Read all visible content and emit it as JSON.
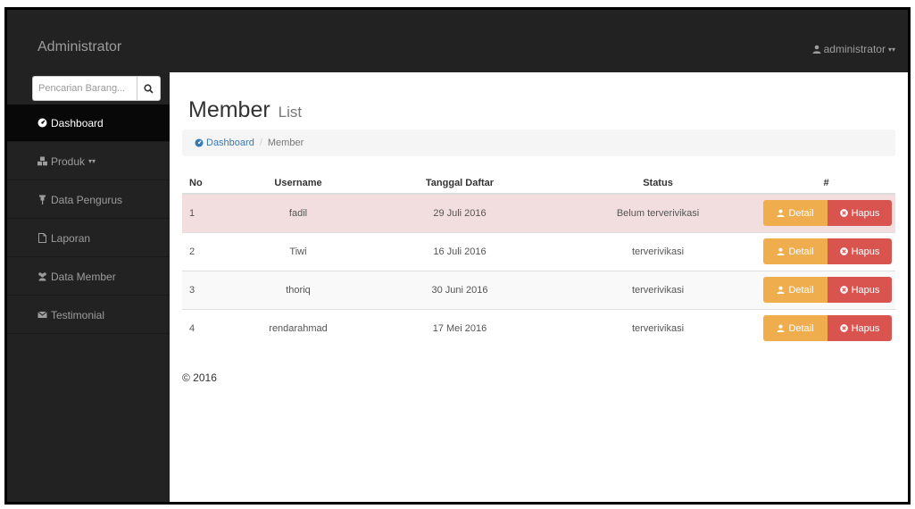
{
  "navbar": {
    "brand": "Administrator",
    "user_label": "administrator",
    "user_icon": "user-icon",
    "caret": "▾▾"
  },
  "sidebar": {
    "search_placeholder": "Pencarian Barang...",
    "search_icon": "search-icon",
    "items": [
      {
        "label": "Dashboard",
        "icon": "dashboard-icon",
        "active": true
      },
      {
        "label": "Produk",
        "icon": "cubes-icon",
        "caret": "▾▾"
      },
      {
        "label": "Data Pengurus",
        "icon": "pin-icon"
      },
      {
        "label": "Laporan",
        "icon": "file-icon"
      },
      {
        "label": "Data Member",
        "icon": "users-icon"
      },
      {
        "label": "Testimonial",
        "icon": "envelope-icon"
      }
    ]
  },
  "page": {
    "title": "Member",
    "subtitle": "List"
  },
  "breadcrumb": {
    "home": "Dashboard",
    "separator": "/",
    "current": "Member"
  },
  "table": {
    "headers": [
      "No",
      "Username",
      "Tanggal Daftar",
      "Status",
      "#"
    ],
    "rows": [
      {
        "no": "1",
        "username": "fadil",
        "date": "29 Juli 2016",
        "status": "Belum terverivikasi"
      },
      {
        "no": "2",
        "username": "Tiwi",
        "date": "16 Juli 2016",
        "status": "terverivikasi"
      },
      {
        "no": "3",
        "username": "thoriq",
        "date": "30 Juni 2016",
        "status": "terverivikasi"
      },
      {
        "no": "4",
        "username": "rendarahmad",
        "date": "17 Mei 2016",
        "status": "terverivikasi"
      }
    ],
    "detail_label": "Detail",
    "hapus_label": "Hapus"
  },
  "footer": {
    "text": "© 2016"
  },
  "colors": {
    "navbar_bg": "#222222",
    "warning": "#f0ad4e",
    "danger": "#d9534f",
    "danger_row": "#f2dede",
    "link": "#337ab7"
  }
}
